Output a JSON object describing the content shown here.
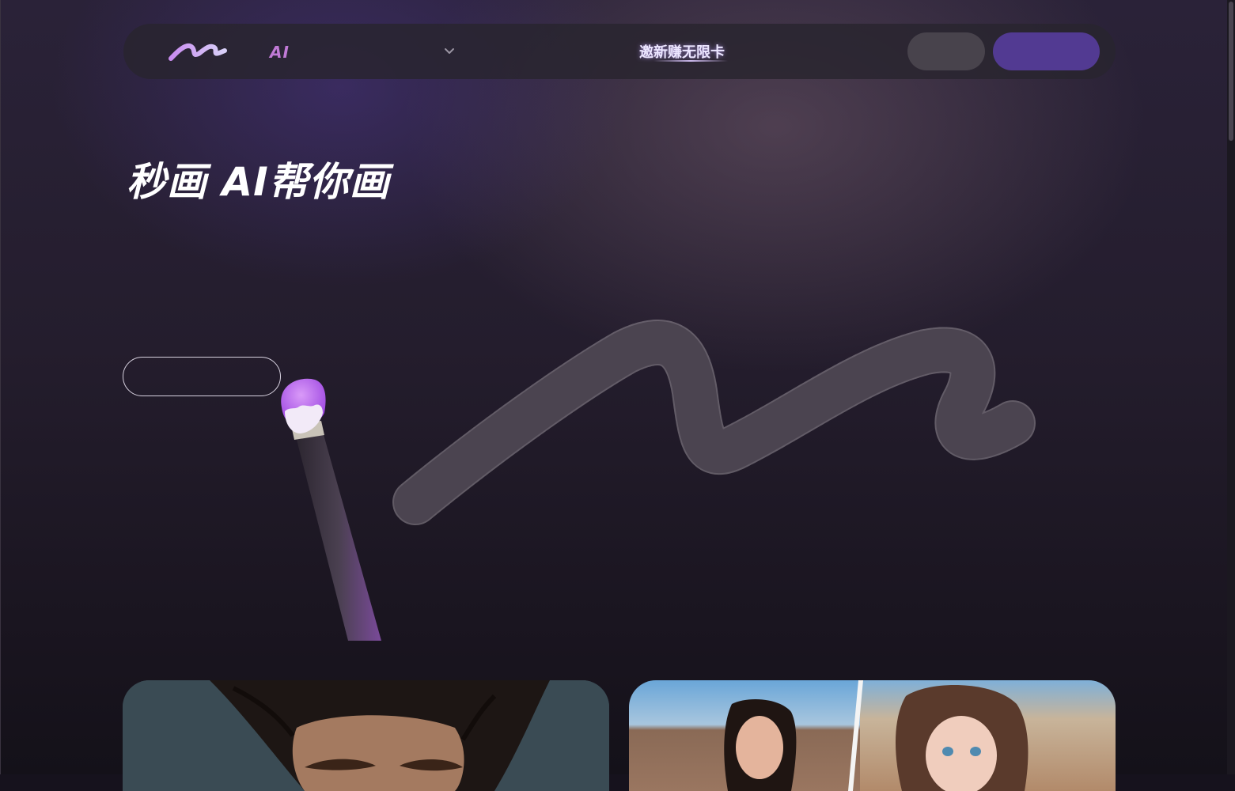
{
  "nav": {
    "logo_icon": "m-squiggle-logo",
    "product_label": "AI",
    "dropdown_icon": "chevron-down-icon",
    "invite_text": "邀新赚无限卡",
    "login_label": "",
    "signup_label": ""
  },
  "hero": {
    "title": "秒画 AI帮你画",
    "cta_label": ""
  },
  "colors": {
    "accent": "#523a92",
    "logo_gradient_start": "#b07ce8",
    "logo_gradient_end": "#7c5bd9",
    "nav_ai": "#c07ad6",
    "brush_tip": "#b25ff0"
  },
  "gallery": {
    "cards": [
      {
        "description_icon": "portrait-photo-image"
      },
      {
        "description_icon": "before-after-portrait-image"
      }
    ]
  }
}
